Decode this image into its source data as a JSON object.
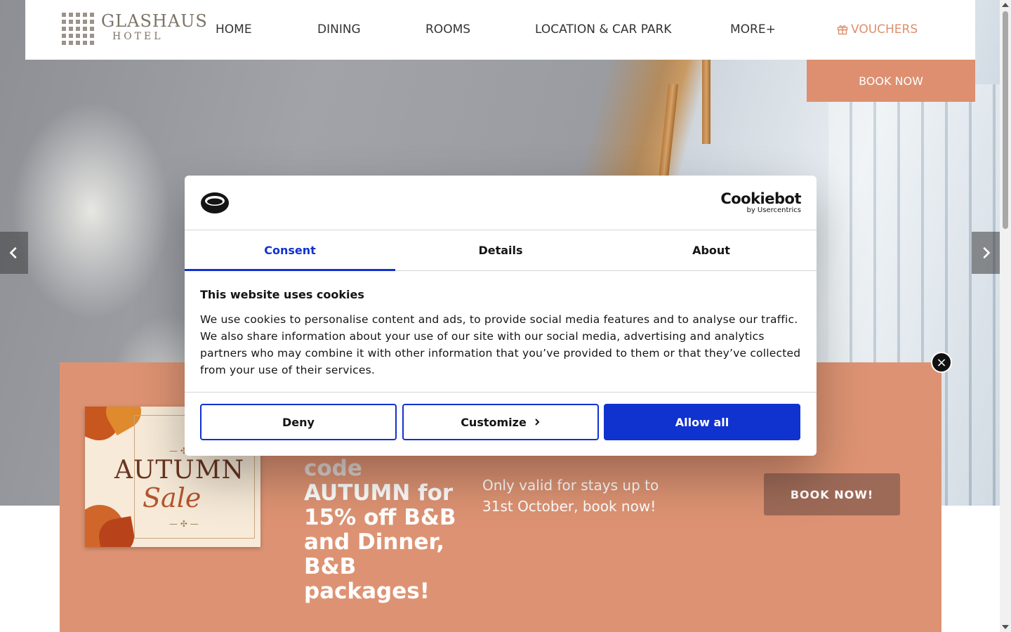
{
  "header": {
    "logo_text_main": "GLASHAUS",
    "logo_text_sub": "HOTEL",
    "nav": [
      {
        "label": "HOME"
      },
      {
        "label": "DINING"
      },
      {
        "label": "ROOMS"
      },
      {
        "label": "LOCATION & CAR PARK"
      },
      {
        "label": "MORE+"
      },
      {
        "label": "VOUCHERS",
        "icon": "gift-icon"
      }
    ],
    "book_now_label": "BOOK NOW"
  },
  "carousel": {
    "prev_icon": "chevron-left-icon",
    "next_icon": "chevron-right-icon"
  },
  "promo": {
    "image_title": "AUTUMN",
    "image_subtitle": "Sale",
    "headline_partial": "code",
    "headline": "AUTUMN for 15% off B&B and Dinner, B&B packages!",
    "subtext": "Only valid for stays up to 31st October, book now!",
    "button_label": "BOOK NOW!",
    "close_label": "×"
  },
  "cookie": {
    "brand": "Cookiebot",
    "brand_sub": "by Usercentrics",
    "tabs": [
      {
        "label": "Consent",
        "active": true
      },
      {
        "label": "Details",
        "active": false
      },
      {
        "label": "About",
        "active": false
      }
    ],
    "title": "This website uses cookies",
    "text": "We use cookies to personalise content and ads, to provide social media features and to analyse our traffic. We also share information about your use of our site with our social media, advertising and analytics partners who may combine it with other information that you’ve provided to them or that they’ve collected from your use of their services.",
    "buttons": {
      "deny": "Deny",
      "customize": "Customize",
      "allow_all": "Allow all"
    }
  },
  "colors": {
    "accent": "#dd8f6f",
    "cookie_primary": "#1032cf",
    "promo_bg": "#dd9373",
    "promo_button": "#9e6a58"
  }
}
